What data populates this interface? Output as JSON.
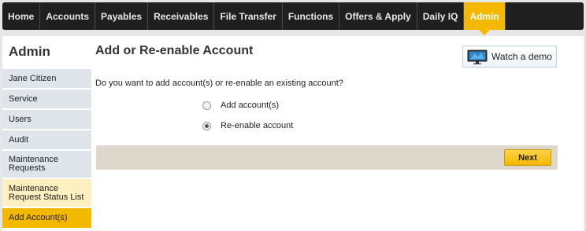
{
  "nav": {
    "tabs": [
      {
        "label": "Home"
      },
      {
        "label": "Accounts"
      },
      {
        "label": "Payables"
      },
      {
        "label": "Receivables"
      },
      {
        "label": "File Transfer"
      },
      {
        "label": "Functions"
      },
      {
        "label": "Offers & Apply"
      },
      {
        "label": "Daily IQ"
      },
      {
        "label": "Admin"
      }
    ],
    "active": "Admin"
  },
  "sidebar": {
    "title": "Admin",
    "items": [
      {
        "label": "Jane Citizen"
      },
      {
        "label": "Service"
      },
      {
        "label": "Users"
      },
      {
        "label": "Audit"
      },
      {
        "label": "Maintenance Requests"
      },
      {
        "label": "Maintenance Request Status List"
      },
      {
        "label": "Add Account(s)"
      }
    ]
  },
  "main": {
    "title": "Add or Re-enable Account",
    "watch_demo_label": "Watch a demo",
    "question": "Do you want to add account(s) or re-enable an existing account?",
    "options": [
      {
        "label": "Add account(s)",
        "checked": false
      },
      {
        "label": "Re-enable account",
        "checked": true
      }
    ],
    "next_label": "Next"
  },
  "colors": {
    "accent": "#f4b800",
    "nav_bg": "#1f1f1f",
    "sidebar_bg": "#dfe5ea",
    "action_bar_bg": "#ddd7cc"
  },
  "icons": {
    "watch_demo": "tv-screen-icon"
  }
}
